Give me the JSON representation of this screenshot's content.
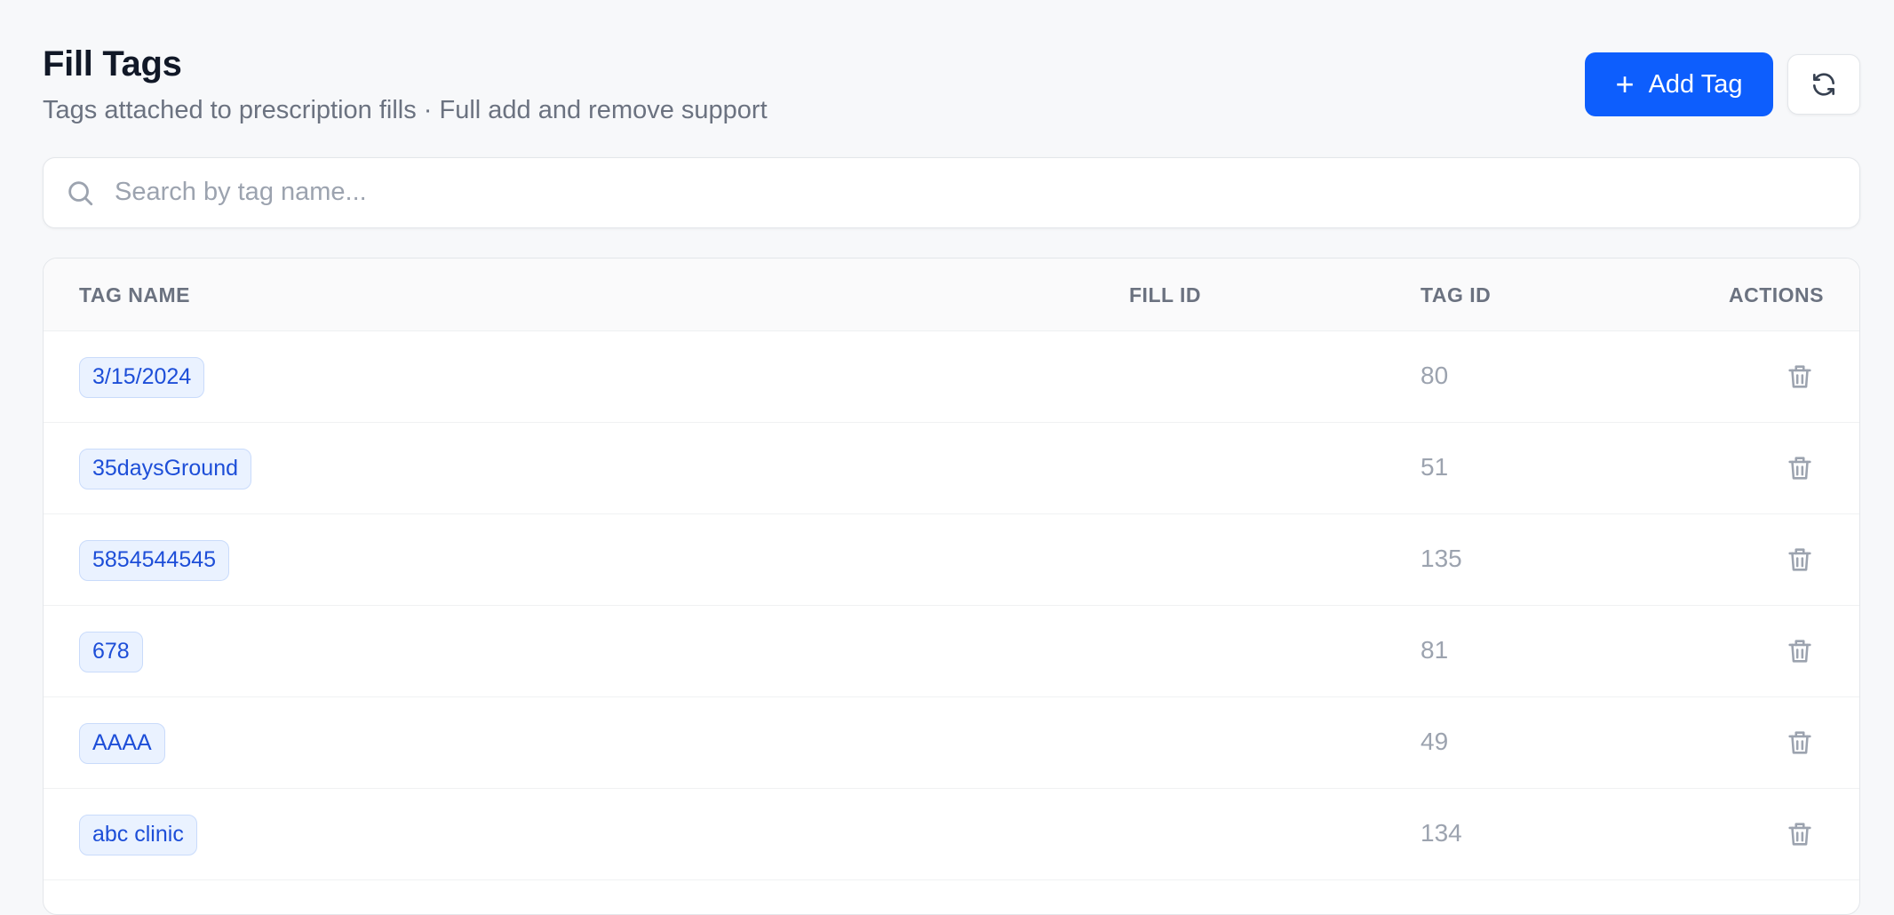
{
  "header": {
    "title": "Fill Tags",
    "subtitle": "Tags attached to prescription fills · Full add and remove support",
    "add_button_label": "Add Tag",
    "add_button_icon": "plus-icon",
    "refresh_button_icon": "refresh-icon"
  },
  "search": {
    "placeholder": "Search by tag name...",
    "value": "",
    "icon": "search-icon"
  },
  "table": {
    "columns": [
      "TAG NAME",
      "FILL ID",
      "TAG ID",
      "ACTIONS"
    ],
    "rows": [
      {
        "tag_name": "3/15/2024",
        "fill_id": "",
        "tag_id": "80"
      },
      {
        "tag_name": "35daysGround",
        "fill_id": "",
        "tag_id": "51"
      },
      {
        "tag_name": "5854544545",
        "fill_id": "",
        "tag_id": "135"
      },
      {
        "tag_name": "678",
        "fill_id": "",
        "tag_id": "81"
      },
      {
        "tag_name": "AAAA",
        "fill_id": "",
        "tag_id": "49"
      },
      {
        "tag_name": "abc clinic",
        "fill_id": "",
        "tag_id": "134"
      }
    ],
    "row_action_icon": "trash-icon"
  },
  "colors": {
    "accent": "#0d5efd",
    "tag_bg": "#eaf2ff",
    "tag_text": "#1d4ed8",
    "muted_text": "#9ca3af",
    "background": "#f7f8fa"
  }
}
